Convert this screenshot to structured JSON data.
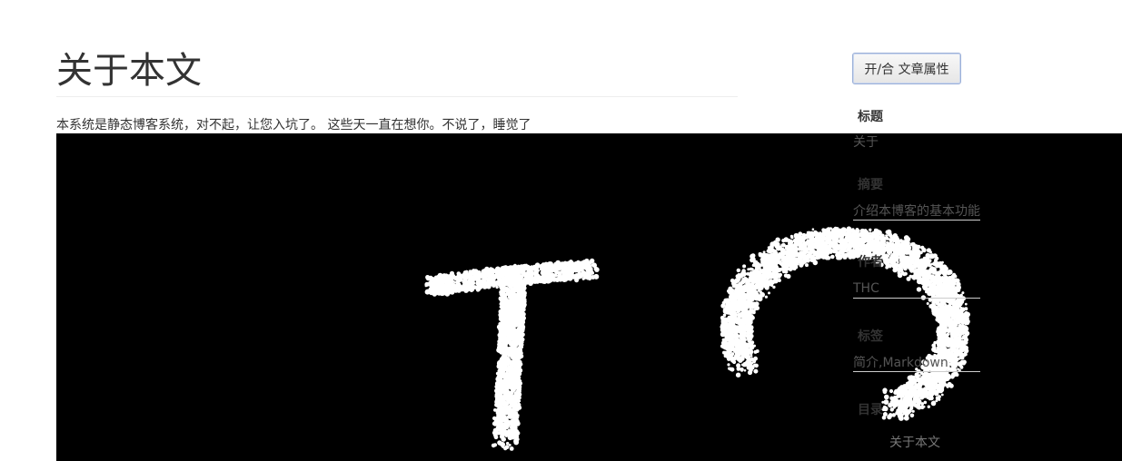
{
  "article": {
    "title": "关于本文",
    "intro": "本系统是静态博客系统，对不起，让您入坑了。 这些天一直在想你。不说了，睡觉了"
  },
  "canvas": {
    "letters": [
      "T",
      "C"
    ],
    "background_color": "#000000",
    "letter_color": "#ffffff"
  },
  "sidebar": {
    "toggle_label": "开/合 文章属性",
    "fields": {
      "title_label": "标题",
      "title_value": "关于",
      "summary_label": "摘要",
      "summary_value": "介绍本博客的基本功能",
      "author_label": "作者",
      "author_value": "THC",
      "tags_label": "标签",
      "tags_value": "简介,Markdown"
    },
    "toc_label": "目录",
    "toc_items": [
      "关于本文"
    ]
  }
}
